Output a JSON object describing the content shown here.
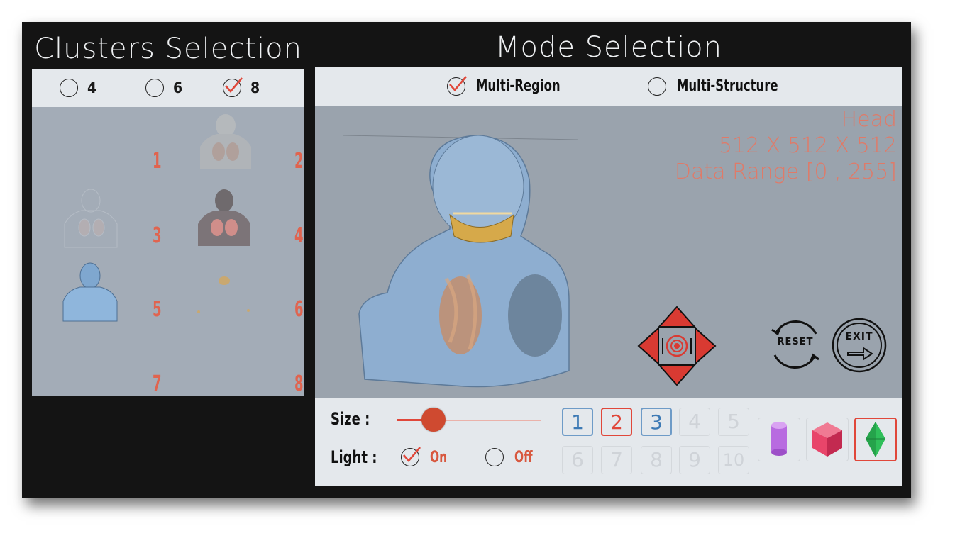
{
  "clusters": {
    "title": "Clusters Selection",
    "options": [
      {
        "label": "4",
        "checked": false
      },
      {
        "label": "6",
        "checked": false
      },
      {
        "label": "8",
        "checked": true
      }
    ],
    "cluster_numbers": [
      "1",
      "2",
      "3",
      "4",
      "5",
      "6",
      "7",
      "8"
    ]
  },
  "mode": {
    "title": "Mode Selection",
    "options": [
      {
        "label": "Multi-Region",
        "checked": true
      },
      {
        "label": "Multi-Structure",
        "checked": false
      }
    ]
  },
  "dataset": {
    "name": "Head",
    "dimensions": "512 X 512 X 512",
    "range": "Data Range [0 , 255]"
  },
  "controls": {
    "reset_label": "RESET",
    "exit_label": "EXIT"
  },
  "footer": {
    "size_label": "Size :",
    "size_value": 0.2,
    "light_label": "Light :",
    "light_on_label": "On",
    "light_off_label": "Off",
    "light_on": true,
    "number_buttons": [
      "1",
      "2",
      "3",
      "4",
      "5",
      "6",
      "7",
      "8",
      "9",
      "10"
    ],
    "enabled_numbers": [
      "1",
      "2",
      "3"
    ],
    "selected_number": "2",
    "shape_buttons": [
      {
        "icon": "cylinder-icon",
        "color": "#b86be0"
      },
      {
        "icon": "cube-icon",
        "color": "#e8456a"
      },
      {
        "icon": "diamond-icon",
        "color": "#2fbf5a",
        "selected": true
      }
    ]
  },
  "colors": {
    "accent_red": "#e0473a",
    "info_red": "#e07a68",
    "panel_gray": "#9aa3ad",
    "header_light": "#e4e8ec"
  }
}
